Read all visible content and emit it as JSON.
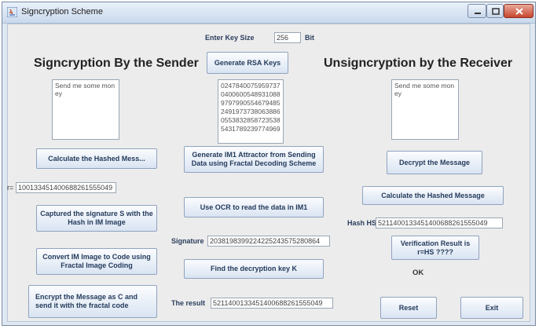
{
  "window": {
    "title": "Signcryption Scheme"
  },
  "key_size": {
    "label": "Enter Key Size",
    "value": "256",
    "unit": "Bit"
  },
  "sender": {
    "heading": "Signcryption By the Sender",
    "message": "Send me some money",
    "message_lines": [
      "Send me some mon",
      "ey"
    ]
  },
  "receiver": {
    "heading": "Unsigncryption by the Receiver",
    "message": "Send me some money",
    "message_lines": [
      "Send me some mon",
      "ey"
    ]
  },
  "rsa_keys": [
    "0247840075959737",
    "0400600548931088",
    "9797990554679485",
    "2491973738063886",
    "0553832858723538",
    "5431789239774969"
  ],
  "buttons": {
    "generate_rsa": "Generate RSA Keys",
    "calc_hashed_sender": "Calculate the Hashed Mess...",
    "generate_im1": "Generate IM1 Attractor from Sending Data using Fractal Decoding Scheme",
    "decrypt": "Decrypt the Message",
    "calc_hashed_receiver": "Calculate the Hashed Message",
    "captured_signature": "Captured the signature S with the Hash in IM Image",
    "use_ocr": "Use OCR to read the data in IM1",
    "verification": "Verification Result is r=HS ????",
    "convert_im": "Convert IM Image to Code using Fractal Image Coding",
    "find_key": "Find the decryption key K",
    "encrypt": "Encrypt the Message as C and send it with the fractal code",
    "reset": "Reset",
    "exit": "Exit"
  },
  "r": {
    "label": "r=",
    "value": "100133451400688261555049"
  },
  "hash_hs": {
    "label": "Hash HS",
    "value": "521140013345140068826155504​9"
  },
  "signature": {
    "label": "Signature",
    "value": "203819839922422524357528086​4"
  },
  "result": {
    "label": "The result",
    "value": "521140013345140068826155504​9"
  },
  "status": {
    "text": "OK"
  }
}
